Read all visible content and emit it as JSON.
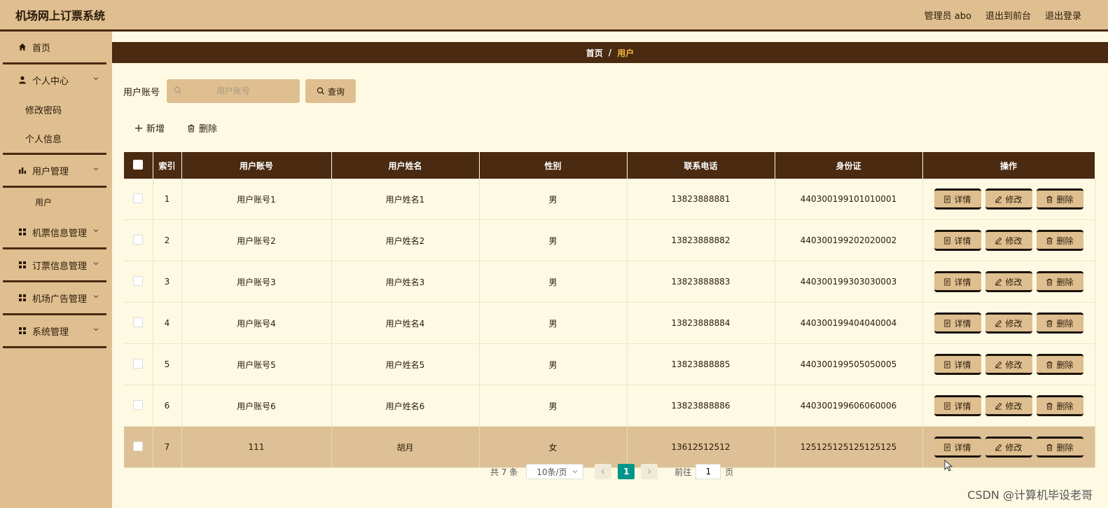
{
  "header": {
    "title": "机场网上订票系统",
    "admin_label": "管理员 abo",
    "to_frontend": "退出到前台",
    "logout": "退出登录"
  },
  "sidebar": {
    "home": "首页",
    "personal_center": "个人中心",
    "change_password": "修改密码",
    "personal_info": "个人信息",
    "user_management": "用户管理",
    "users": "用户",
    "ticket_info_management": "机票信息管理",
    "booking_info_management": "订票信息管理",
    "ad_management": "机场广告管理",
    "system_management": "系统管理"
  },
  "breadcrumb": {
    "home": "首页",
    "separator": "/",
    "current": "用户"
  },
  "search": {
    "label": "用户账号",
    "placeholder": "用户账号",
    "query_button": "查询"
  },
  "actions": {
    "add": "新增",
    "delete": "删除"
  },
  "table": {
    "columns": [
      "索引",
      "用户账号",
      "用户姓名",
      "性别",
      "联系电话",
      "身份证",
      "操作"
    ],
    "rows": [
      {
        "index": "1",
        "account": "用户账号1",
        "name": "用户姓名1",
        "gender": "男",
        "phone": "13823888881",
        "id_card": "440300199101010001"
      },
      {
        "index": "2",
        "account": "用户账号2",
        "name": "用户姓名2",
        "gender": "男",
        "phone": "13823888882",
        "id_card": "440300199202020002"
      },
      {
        "index": "3",
        "account": "用户账号3",
        "name": "用户姓名3",
        "gender": "男",
        "phone": "13823888883",
        "id_card": "440300199303030003"
      },
      {
        "index": "4",
        "account": "用户账号4",
        "name": "用户姓名4",
        "gender": "男",
        "phone": "13823888884",
        "id_card": "440300199404040004"
      },
      {
        "index": "5",
        "account": "用户账号5",
        "name": "用户姓名5",
        "gender": "男",
        "phone": "13823888885",
        "id_card": "440300199505050005"
      },
      {
        "index": "6",
        "account": "用户账号6",
        "name": "用户姓名6",
        "gender": "男",
        "phone": "13823888886",
        "id_card": "440300199606060006"
      },
      {
        "index": "7",
        "account": "111",
        "name": "胡月",
        "gender": "女",
        "phone": "13612512512",
        "id_card": "125125125125125125"
      }
    ],
    "row_actions": {
      "detail": "详情",
      "edit": "修改",
      "delete": "删除"
    }
  },
  "pagination": {
    "total_text": "共 7 条",
    "page_size": "10条/页",
    "current_page": "1",
    "goto_prefix": "前往",
    "goto_value": "1",
    "goto_suffix": "页"
  },
  "watermark": "CSDN @计算机毕设老哥",
  "colors": {
    "tan": "#dfbf90",
    "dark_brown": "#4a2a10",
    "cream": "#fdf9e3",
    "highlight_row": "#ddc095",
    "crumb_current": "#f3b93e",
    "pager_active": "#009688"
  }
}
